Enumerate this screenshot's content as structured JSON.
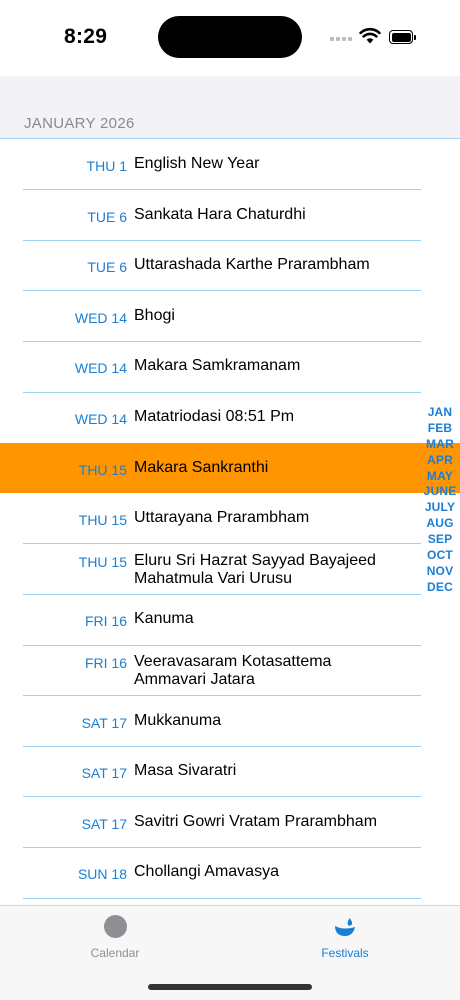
{
  "status_bar": {
    "time": "8:29"
  },
  "section": {
    "title": "JANUARY 2026"
  },
  "festivals": [
    {
      "date": "THU 1",
      "name": "English New Year"
    },
    {
      "date": "TUE 6",
      "name": "Sankata Hara Chaturdhi"
    },
    {
      "date": "TUE 6",
      "name": "Uttarashada Karthe Prarambham"
    },
    {
      "date": "WED 14",
      "name": "Bhogi"
    },
    {
      "date": "WED 14",
      "name": "Makara Samkramanam"
    },
    {
      "date": "WED 14",
      "name": "Matatriodasi 08:51 Pm"
    },
    {
      "date": "THU 15",
      "name": "Makara Sankranthi"
    },
    {
      "date": "THU 15",
      "name": "Uttarayana Prarambham"
    },
    {
      "date": "THU 15",
      "name": "Eluru Sri Hazrat Sayyad Bayajeed Mahatmula Vari Urusu"
    },
    {
      "date": "FRI 16",
      "name": "Kanuma"
    },
    {
      "date": "FRI 16",
      "name": "Veeravasaram Kotasattema Ammavari Jatara"
    },
    {
      "date": "SAT 17",
      "name": "Mukkanuma"
    },
    {
      "date": "SAT 17",
      "name": "Masa Sivaratri"
    },
    {
      "date": "SAT 17",
      "name": "Savitri Gowri Vratam Prarambham"
    },
    {
      "date": "SUN 18",
      "name": "Chollangi Amavasya"
    }
  ],
  "selected_index": 6,
  "month_index": [
    "JAN",
    "FEB",
    "MAR",
    "APR",
    "MAY",
    "JUNE",
    "JULY",
    "AUG",
    "SEP",
    "OCT",
    "NOV",
    "DEC"
  ],
  "tab_bar": {
    "tabs": [
      {
        "label": "Calendar",
        "icon": "calendar-icon",
        "selected": false
      },
      {
        "label": "Festivals",
        "icon": "festival-lamp-icon",
        "selected": true
      }
    ]
  },
  "colors": {
    "accent": "#1a7fd4",
    "highlight": "#ff9500",
    "separator": "#9fd3ee",
    "section_background": "#f2f2f7"
  }
}
